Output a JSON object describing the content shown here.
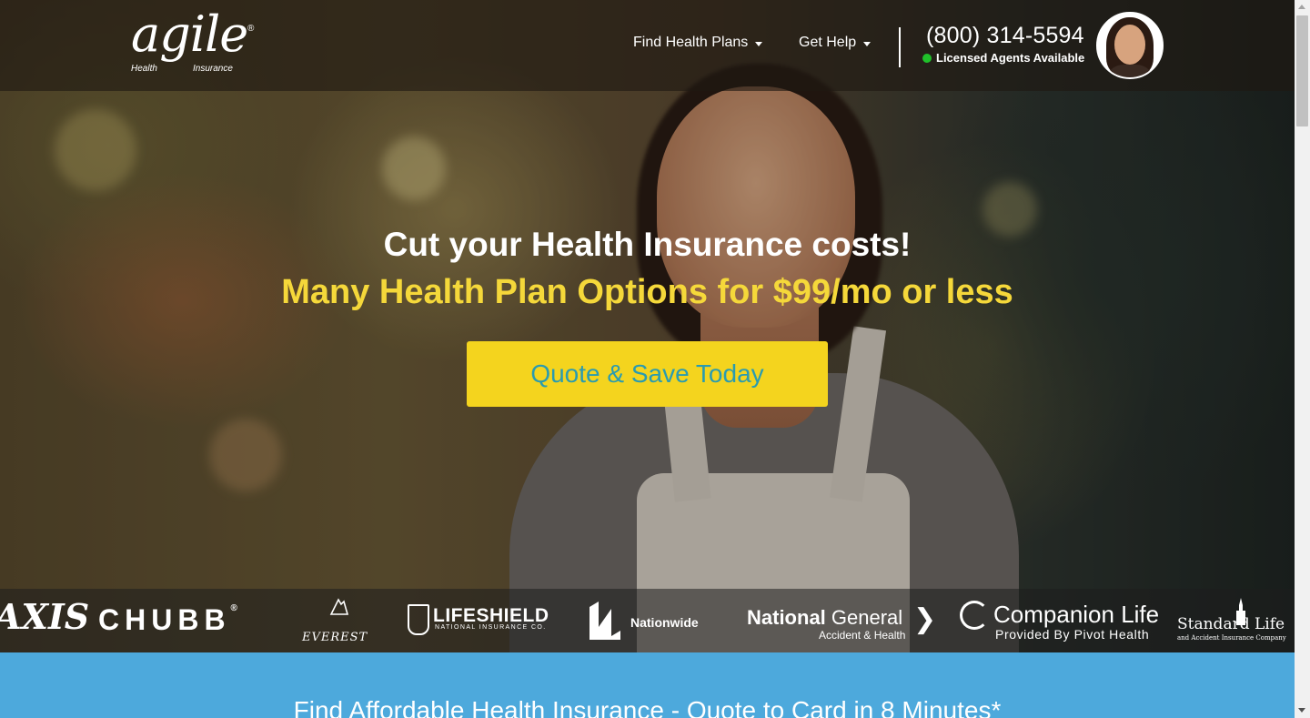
{
  "header": {
    "logo": {
      "word": "agile",
      "reg": "®",
      "sub_left": "Health",
      "sub_right": "Insurance"
    },
    "nav": [
      {
        "label": "Find Health Plans"
      },
      {
        "label": "Get Help"
      }
    ],
    "phone": "(800) 314-5594",
    "agents_status": "Licensed Agents Available",
    "status_color": "#1fc02a"
  },
  "hero": {
    "headline": "Cut your Health Insurance costs!",
    "subheadline": "Many Health Plan Options for $99/mo or less",
    "cta_label": "Quote & Save Today",
    "colors": {
      "cta_background": "#f4d41e",
      "cta_text": "#2a9bb0",
      "subheadline": "#f5d83a"
    }
  },
  "carriers": {
    "axis": "AXIS",
    "chubb": "CHUBB",
    "chubb_reg": "®",
    "everest": "EVEREST",
    "lifeshield": "LIFESHIELD",
    "lifeshield_sub": "NATIONAL INSURANCE CO.",
    "nationwide": "Nationwide",
    "national_general_bold": "National",
    "national_general_rest": " General",
    "national_general_sub": "Accident & Health",
    "companion_life": "Companion Life",
    "companion_life_sub": "Provided By Pivot Health",
    "standard_life": "Standard Life",
    "standard_life_sub": "and Accident Insurance Company"
  },
  "band": {
    "title": "Find Affordable Health Insurance - Quote to Card in 8 Minutes*",
    "color": "#4da9dc"
  }
}
